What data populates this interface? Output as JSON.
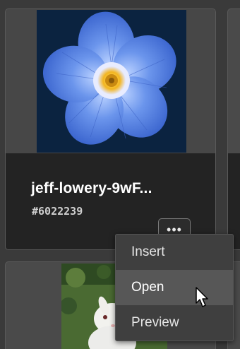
{
  "asset_card": {
    "title": "jeff-lowery-9wF...",
    "id": "#6022239",
    "more_label": "•••"
  },
  "context_menu": {
    "items": [
      {
        "label": "Insert"
      },
      {
        "label": "Open"
      },
      {
        "label": "Preview"
      }
    ],
    "hovered_item": "Open"
  },
  "colors": {
    "panel_bg": "#3a3a3a",
    "card_info_bg": "#232323",
    "menu_bg": "#3f3f3f",
    "menu_hover_bg": "#575757",
    "thumb_bg": "#0b2340",
    "flower_petal": "#5c8be8"
  },
  "icons": {
    "more": "ellipsis-icon",
    "cursor": "mouse-pointer-icon"
  }
}
